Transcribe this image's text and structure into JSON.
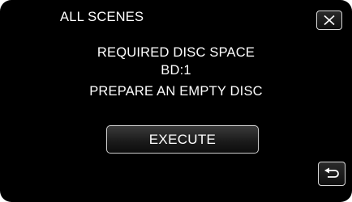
{
  "header": {
    "title": "ALL SCENES",
    "close_icon": "close-icon"
  },
  "message": {
    "line1": "REQUIRED DISC SPACE",
    "line2": "BD:1",
    "line3": "PREPARE AN EMPTY DISC"
  },
  "actions": {
    "execute_label": "EXECUTE",
    "back_icon": "return-arrow-icon"
  },
  "colors": {
    "background": "#000000",
    "text": "#ffffff",
    "button_border": "#cfcfcf"
  }
}
